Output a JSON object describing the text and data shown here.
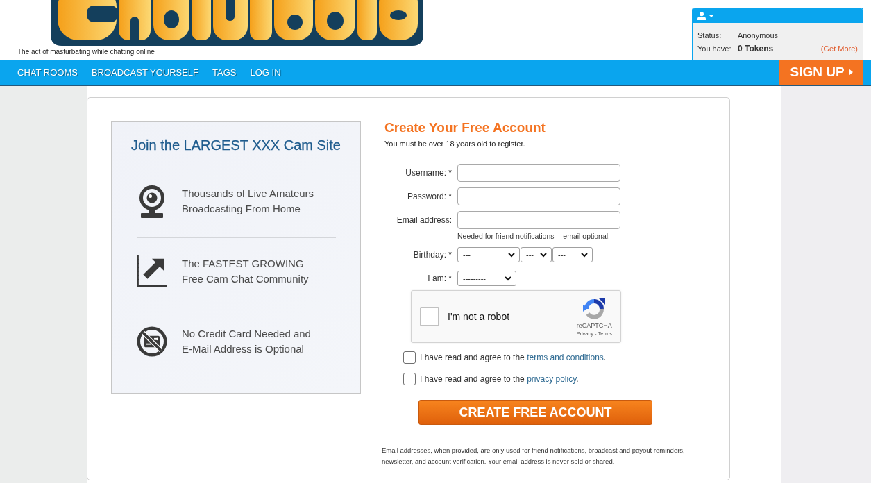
{
  "header": {
    "tagline": "The act of masturbating while chatting online",
    "account": {
      "status_label": "Status:",
      "status": "Anonymous",
      "tokens_label": "You have:",
      "tokens": "0 Tokens",
      "get_more": "(Get More)"
    }
  },
  "nav": {
    "items": [
      "CHAT ROOMS",
      "BROADCAST YOURSELF",
      "TAGS",
      "LOG IN"
    ],
    "signup": "SIGN UP"
  },
  "promo": {
    "title": "Join the LARGEST XXX Cam Site",
    "features": [
      {
        "lines": [
          "Thousands of Live Amateurs",
          "Broadcasting From Home"
        ]
      },
      {
        "lines": [
          "The FASTEST GROWING",
          "Free Cam Chat Community"
        ]
      },
      {
        "lines": [
          "No Credit Card Needed and",
          "E-Mail Address is Optional"
        ]
      }
    ]
  },
  "form": {
    "title": "Create Your Free Account",
    "subtitle": "You must be over 18 years old to register.",
    "fields": [
      {
        "kind": "text",
        "label": "Username: *"
      },
      {
        "kind": "password",
        "label": "Password: *"
      },
      {
        "kind": "email",
        "label": "Email address:",
        "hint": "Needed for friend notifications -- email optional."
      },
      {
        "kind": "select",
        "label": "Birthday: *",
        "selects": [
          "---",
          "---",
          "---"
        ]
      },
      {
        "kind": "select",
        "label": "I am: *",
        "selects": [
          "---------"
        ]
      }
    ],
    "captcha": {
      "label": "I'm not a robot",
      "checked": false,
      "brand": "reCAPTCHA",
      "links": "Privacy - Terms"
    },
    "consents": [
      {
        "before": "I have read and agree to the ",
        "link": "terms and conditions",
        "after": ".",
        "checked": false
      },
      {
        "before": "I have read and agree to the ",
        "link": "privacy policy",
        "after": ".",
        "checked": false
      }
    ],
    "submit": "CREATE FREE ACCOUNT",
    "disclaimer": [
      "Email addresses, when provided, are only used for friend notifications, broadcast and payout reminders,",
      "newsletter, and account verification. Your email address is never sold or shared."
    ]
  }
}
